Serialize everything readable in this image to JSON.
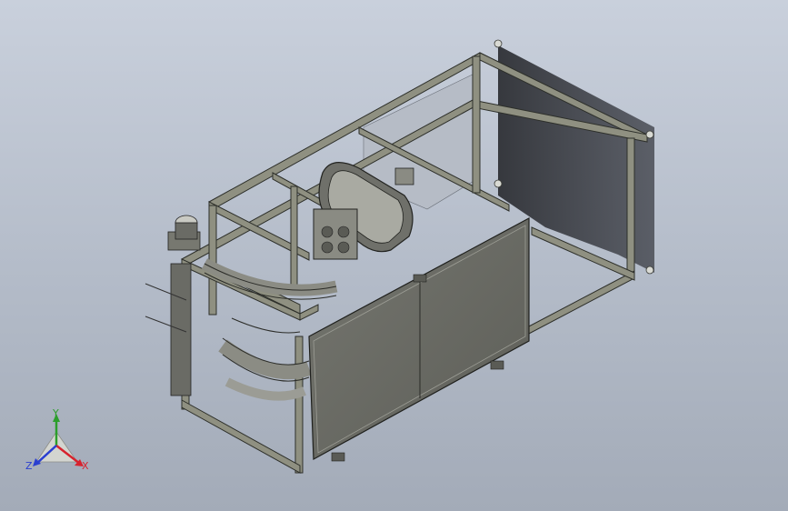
{
  "viewport": {
    "background_top": "#c9d0dc",
    "background_bottom": "#a3abb8"
  },
  "model": {
    "frame_color": "#8f9081",
    "frame_edge": "#2d2f2a",
    "panel_color": "#6c6d66",
    "shadow_color": "#3e4045",
    "chain_color": "#9b9c95"
  },
  "triad": {
    "x_label": "X",
    "y_label": "Y",
    "z_label": "Z",
    "x_color": "#d7232e",
    "y_color": "#2c9e2c",
    "z_color": "#2a3fd0"
  }
}
